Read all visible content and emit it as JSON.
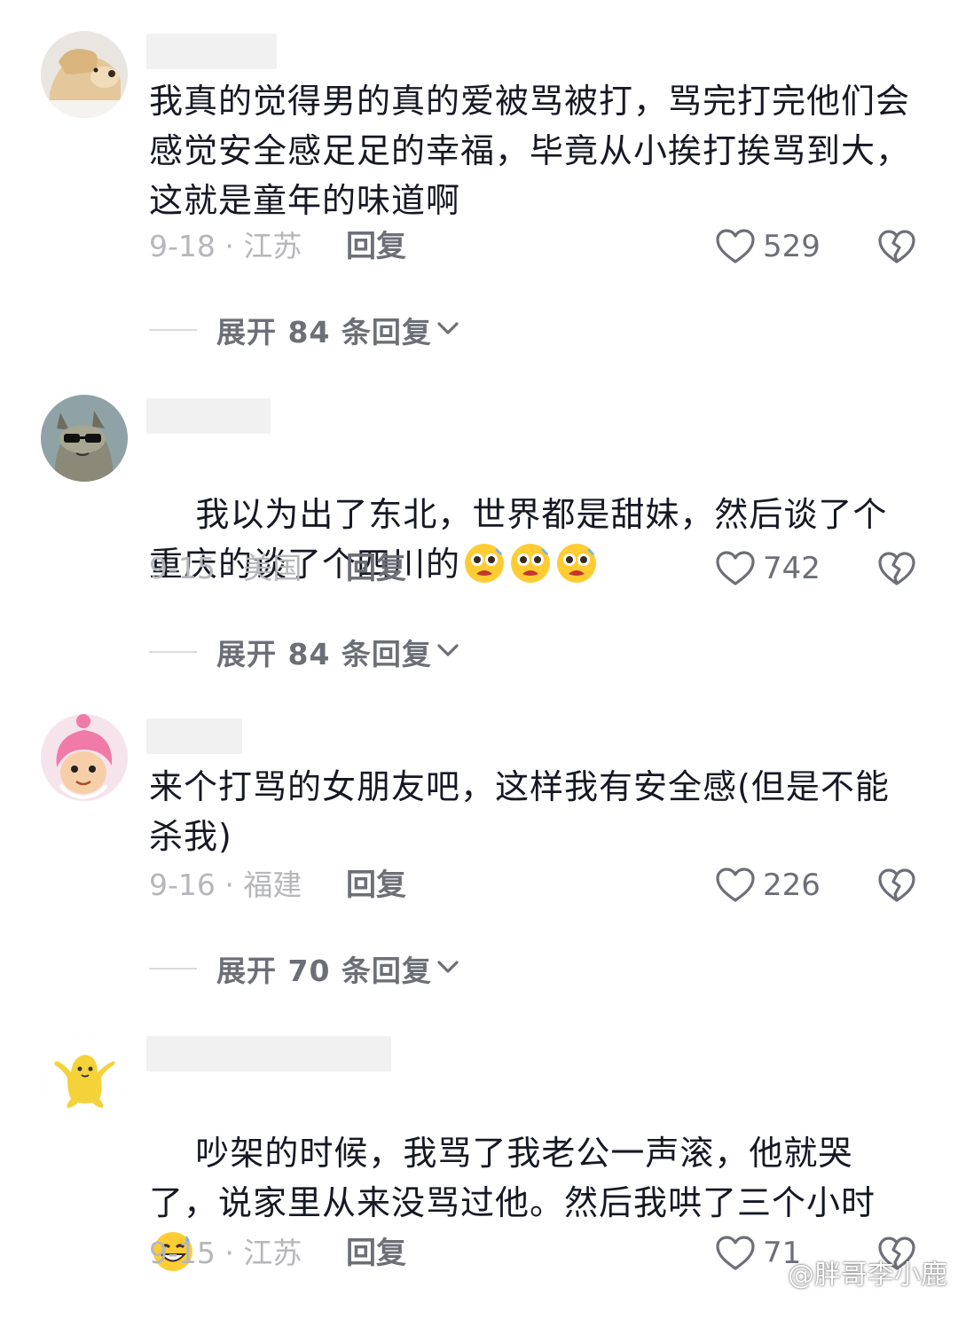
{
  "comments": [
    {
      "username": "",
      "avatar": "dog-avatar",
      "text": "我真的觉得男的真的爱被骂被打，骂完打完他们会感觉安全感足足的幸福，毕竟从小挨打挨骂到大，这就是童年的味道啊",
      "date_location": "9-18 · 江苏",
      "reply_label": "回复",
      "likes": "529",
      "expand_label": "展开 84 条回复"
    },
    {
      "username": "",
      "avatar": "raccoon-sunglasses-avatar",
      "text": "我以为出了东北，世界都是甜妹，然后谈了个重庆的谈了个四川的",
      "emojis": [
        "pleading-emoji",
        "pleading-emoji",
        "pleading-emoji"
      ],
      "date_location": "9-15 · 美国",
      "reply_label": "回复",
      "likes": "742",
      "expand_label": "展开 84 条回复"
    },
    {
      "username": "",
      "avatar": "pink-cartoon-avatar",
      "text": "来个打骂的女朋友吧，这样我有安全感(但是不能杀我)",
      "date_location": "9-16 · 福建",
      "reply_label": "回复",
      "likes": "226",
      "expand_label": "展开 70 条回复"
    },
    {
      "username": "",
      "avatar": "yellow-blob-avatar",
      "text": "吵架的时候，我骂了我老公一声滚，他就哭了，说家里从来没骂过他。然后我哄了三个小时",
      "emojis": [
        "grin-sweat-emoji"
      ],
      "date_location": "9-15 · 江苏",
      "reply_label": "回复",
      "likes": "71"
    }
  ],
  "watermark": "@胖哥李小鹿",
  "colors": {
    "text_primary": "#161823",
    "text_secondary": "#6d6f77",
    "text_muted": "#b6b7ba",
    "username_placeholder": "#f1f1f1"
  }
}
